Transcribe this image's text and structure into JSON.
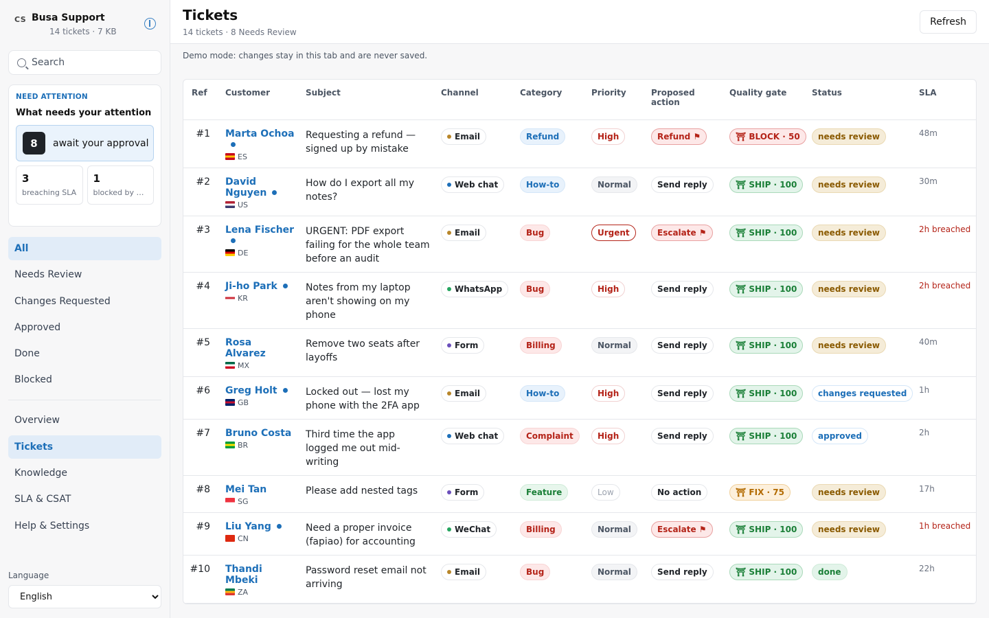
{
  "brand": {
    "badge": "CS",
    "name": "Busa Support",
    "meta": "14 tickets · 7 KB"
  },
  "search": {
    "placeholder": "Search"
  },
  "attention": {
    "eyebrow": "NEED ATTENTION",
    "title": "What needs your attention",
    "main_count": "8",
    "main_label": "await your approval",
    "sla_count": "3",
    "sla_label": "breaching SLA",
    "blocked_count": "1",
    "blocked_label": "blocked by g..."
  },
  "filters": [
    "All",
    "Needs Review",
    "Changes Requested",
    "Approved",
    "Done",
    "Blocked"
  ],
  "nav": [
    "Overview",
    "Tickets",
    "Knowledge",
    "SLA & CSAT",
    "Help & Settings"
  ],
  "language": {
    "label": "Language",
    "value": "English"
  },
  "header": {
    "title": "Tickets",
    "subtitle": "14 tickets · 8 Needs Review",
    "refresh": "Refresh"
  },
  "demo_notice": "Demo mode: changes stay in this tab and are never saved.",
  "columns": [
    "Ref",
    "Customer",
    "Subject",
    "Channel",
    "Category",
    "Priority",
    "Proposed action",
    "Quality gate",
    "Status",
    "SLA"
  ],
  "tickets": [
    {
      "ref": "#1",
      "customer": "Marta Ochoa",
      "unread": true,
      "country": "ES",
      "flag": [
        "#c60b1e",
        "#ffc400",
        "#c60b1e"
      ],
      "subject": "Requesting a refund — signed up by mistake",
      "channel": "Email",
      "channel_color": "#b8862a",
      "category": "Refund",
      "category_style": "blue",
      "priority": "High",
      "priority_style": "high",
      "action": "Refund ⚑",
      "action_style": "warn",
      "gate": "⛩ BLOCK · 50",
      "gate_style": "block",
      "status": "needs review",
      "status_style": "review",
      "sla": "48m",
      "breached": false
    },
    {
      "ref": "#2",
      "customer": "David Nguyen",
      "unread": true,
      "country": "US",
      "flag": [
        "#b22234",
        "#ffffff",
        "#3c3b6e"
      ],
      "subject": "How do I export all my notes?",
      "channel": "Web chat",
      "channel_color": "#1d6fb8",
      "category": "How-to",
      "category_style": "blue",
      "priority": "Normal",
      "priority_style": "normal",
      "action": "Send reply",
      "action_style": "plain",
      "gate": "⛩ SHIP · 100",
      "gate_style": "ship",
      "status": "needs review",
      "status_style": "review",
      "sla": "30m",
      "breached": false
    },
    {
      "ref": "#3",
      "customer": "Lena Fischer",
      "unread": true,
      "country": "DE",
      "flag": [
        "#000000",
        "#dd0000",
        "#ffce00"
      ],
      "subject": "URGENT: PDF export failing for the whole team before an audit",
      "channel": "Email",
      "channel_color": "#b8862a",
      "category": "Bug",
      "category_style": "red",
      "priority": "Urgent",
      "priority_style": "urgent",
      "action": "Escalate ⚑",
      "action_style": "warn",
      "gate": "⛩ SHIP · 100",
      "gate_style": "ship",
      "status": "needs review",
      "status_style": "review",
      "sla": "2h breached",
      "breached": true
    },
    {
      "ref": "#4",
      "customer": "Ji-ho Park",
      "unread": true,
      "country": "KR",
      "flag": [
        "#ffffff",
        "#cd2e3a",
        "#ffffff"
      ],
      "subject": "Notes from my laptop aren't showing on my phone",
      "channel": "WhatsApp",
      "channel_color": "#25a55f",
      "category": "Bug",
      "category_style": "red",
      "priority": "High",
      "priority_style": "high",
      "action": "Send reply",
      "action_style": "plain",
      "gate": "⛩ SHIP · 100",
      "gate_style": "ship",
      "status": "needs review",
      "status_style": "review",
      "sla": "2h breached",
      "breached": true
    },
    {
      "ref": "#5",
      "customer": "Rosa Alvarez",
      "unread": false,
      "country": "MX",
      "flag": [
        "#006847",
        "#ffffff",
        "#ce1126"
      ],
      "subject": "Remove two seats after layoffs",
      "channel": "Form",
      "channel_color": "#6b4fbb",
      "category": "Billing",
      "category_style": "red",
      "priority": "Normal",
      "priority_style": "normal",
      "action": "Send reply",
      "action_style": "plain",
      "gate": "⛩ SHIP · 100",
      "gate_style": "ship",
      "status": "needs review",
      "status_style": "review",
      "sla": "40m",
      "breached": false
    },
    {
      "ref": "#6",
      "customer": "Greg Holt",
      "unread": true,
      "country": "GB",
      "flag": [
        "#012169",
        "#c8102e",
        "#012169"
      ],
      "subject": "Locked out — lost my phone with the 2FA app",
      "channel": "Email",
      "channel_color": "#b8862a",
      "category": "How-to",
      "category_style": "blue",
      "priority": "High",
      "priority_style": "high",
      "action": "Send reply",
      "action_style": "plain",
      "gate": "⛩ SHIP · 100",
      "gate_style": "ship",
      "status": "changes requested",
      "status_style": "changes",
      "sla": "1h",
      "breached": false
    },
    {
      "ref": "#7",
      "customer": "Bruno Costa",
      "unread": false,
      "country": "BR",
      "flag": [
        "#009c3b",
        "#ffdf00",
        "#009c3b"
      ],
      "subject": "Third time the app logged me out mid-writing",
      "channel": "Web chat",
      "channel_color": "#1d6fb8",
      "category": "Complaint",
      "category_style": "red",
      "priority": "High",
      "priority_style": "high",
      "action": "Send reply",
      "action_style": "plain",
      "gate": "⛩ SHIP · 100",
      "gate_style": "ship",
      "status": "approved",
      "status_style": "approved",
      "sla": "2h",
      "breached": false
    },
    {
      "ref": "#8",
      "customer": "Mei Tan",
      "unread": false,
      "country": "SG",
      "flag": [
        "#ef3340",
        "#ef3340",
        "#ffffff"
      ],
      "subject": "Please add nested tags",
      "channel": "Form",
      "channel_color": "#6b4fbb",
      "category": "Feature",
      "category_style": "green",
      "priority": "Low",
      "priority_style": "low",
      "action": "No action",
      "action_style": "plain",
      "gate": "⛩ FIX · 75",
      "gate_style": "fix",
      "status": "needs review",
      "status_style": "review",
      "sla": "17h",
      "breached": false
    },
    {
      "ref": "#9",
      "customer": "Liu Yang",
      "unread": true,
      "country": "CN",
      "flag": [
        "#de2910",
        "#de2910",
        "#de2910"
      ],
      "subject": "Need a proper invoice (fapiao) for accounting",
      "channel": "WeChat",
      "channel_color": "#25a55f",
      "category": "Billing",
      "category_style": "red",
      "priority": "Normal",
      "priority_style": "normal",
      "action": "Escalate ⚑",
      "action_style": "warn",
      "gate": "⛩ SHIP · 100",
      "gate_style": "ship",
      "status": "needs review",
      "status_style": "review",
      "sla": "1h breached",
      "breached": true
    },
    {
      "ref": "#10",
      "customer": "Thandi Mbeki",
      "unread": false,
      "country": "ZA",
      "flag": [
        "#007a4d",
        "#ffb612",
        "#de3831"
      ],
      "subject": "Password reset email not arriving",
      "channel": "Email",
      "channel_color": "#b8862a",
      "category": "Bug",
      "category_style": "red",
      "priority": "Normal",
      "priority_style": "normal",
      "action": "Send reply",
      "action_style": "plain",
      "gate": "⛩ SHIP · 100",
      "gate_style": "ship",
      "status": "done",
      "status_style": "done",
      "sla": "22h",
      "breached": false
    }
  ],
  "active_filter": "All",
  "active_nav": "Tickets"
}
